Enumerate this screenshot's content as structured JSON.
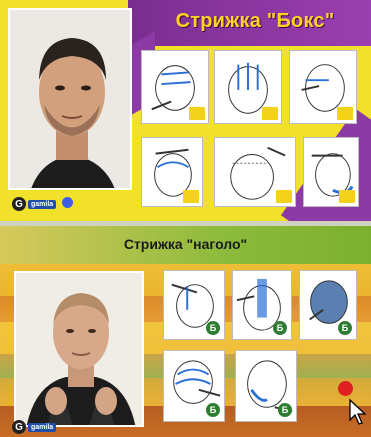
{
  "slide_top": {
    "title": "Стрижка \"Бокс\"",
    "logo_letter": "G",
    "logo_text": "gamila"
  },
  "slide_bottom": {
    "title": "Стрижка \"наголо\"",
    "logo_letter": "G",
    "logo_text": "gamila"
  },
  "icons": {
    "badge_letter": "Б"
  },
  "colors": {
    "top_background": "#f2e12a",
    "purple": "#8b3aa6",
    "title_yellow": "#ffd21f",
    "record_dot": "#e02020",
    "badge_yellow": "#f2d21b",
    "badge_green": "#2f7d32"
  }
}
